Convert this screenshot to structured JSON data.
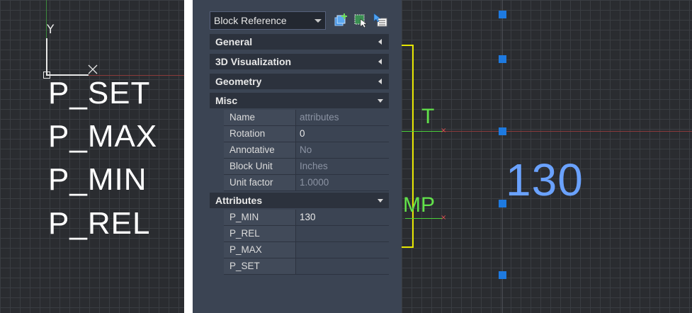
{
  "left_drawing": {
    "axis_y_label": "Y",
    "attribute_tags": [
      "P_SET",
      "P_MAX",
      "P_MIN",
      "P_REL"
    ]
  },
  "palette": {
    "object_type": "Block Reference",
    "toolbar_icons": [
      "add-selected-icon",
      "quick-select-icon",
      "select-objects-icon"
    ],
    "sections": {
      "general": "General",
      "viz3d": "3D Visualization",
      "geometry": "Geometry",
      "misc": "Misc",
      "attributes": "Attributes"
    },
    "misc_rows": [
      {
        "name": "Name",
        "value": "attributes",
        "readonly": true
      },
      {
        "name": "Rotation",
        "value": "0",
        "readonly": false
      },
      {
        "name": "Annotative",
        "value": "No",
        "readonly": true
      },
      {
        "name": "Block Unit",
        "value": "Inches",
        "readonly": true
      },
      {
        "name": "Unit factor",
        "value": "1.0000",
        "readonly": true
      }
    ],
    "attribute_rows": [
      {
        "name": "P_MIN",
        "value": "130"
      },
      {
        "name": "P_REL",
        "value": ""
      },
      {
        "name": "P_MAX",
        "value": ""
      },
      {
        "name": "P_SET",
        "value": ""
      }
    ]
  },
  "right_drawing": {
    "label_top": "T",
    "label_bottom": "MP",
    "attribute_value": "130",
    "colors": {
      "grip": "#1e7ae0",
      "value_text": "#6aa2ff",
      "labels": "#62e24a",
      "bracket": "#e6e600"
    }
  }
}
